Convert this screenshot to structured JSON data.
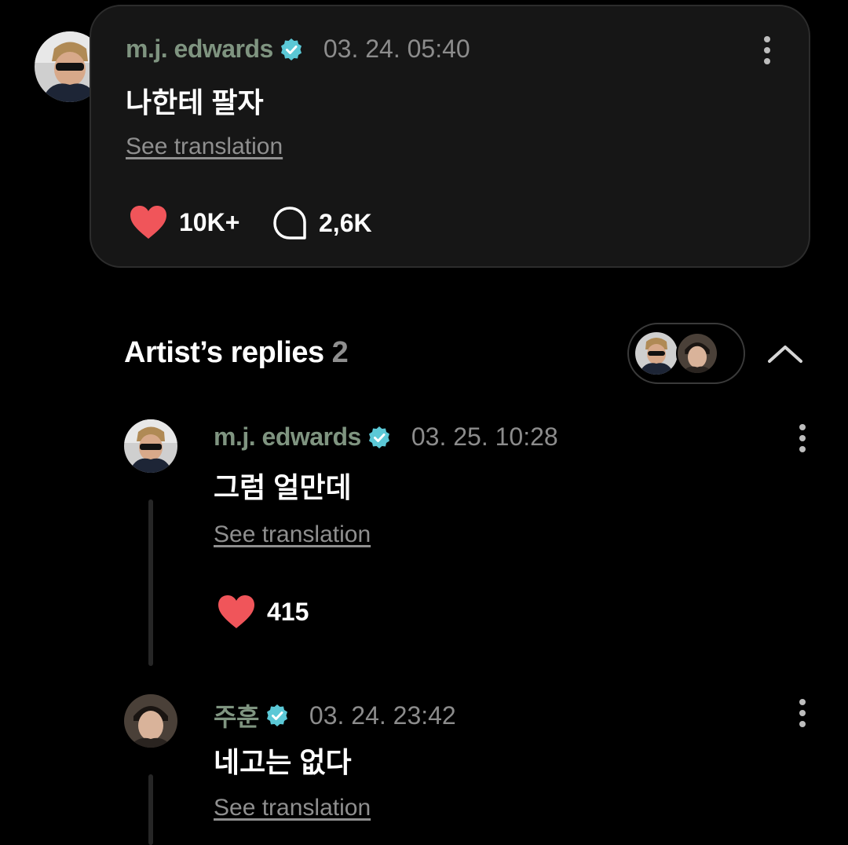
{
  "post": {
    "author": "m.j. edwards",
    "timestamp": "03. 24. 05:40",
    "text": "나한테 팔자",
    "see_translation": "See translation",
    "likes": "10K+",
    "comments": "2,6K"
  },
  "replies_section": {
    "title": "Artist’s replies",
    "count": "2"
  },
  "replies": [
    {
      "author": "m.j. edwards",
      "timestamp": "03. 25. 10:28",
      "text": "그럼 얼만데",
      "see_translation": "See translation",
      "likes": "415"
    },
    {
      "author": "주훈",
      "timestamp": "03. 24. 23:42",
      "text": "네고는 없다",
      "see_translation": "See translation"
    }
  ],
  "colors": {
    "background": "#000000",
    "card": "#161616",
    "author_name": "#7f9480",
    "verified_badge": "#5bc8d6",
    "heart": "#f0555a",
    "muted_text": "#8f8f8f"
  },
  "icons": [
    "verified-badge-icon",
    "heart-icon",
    "comment-bubble-icon",
    "more-options-icon",
    "chevron-up-icon"
  ]
}
